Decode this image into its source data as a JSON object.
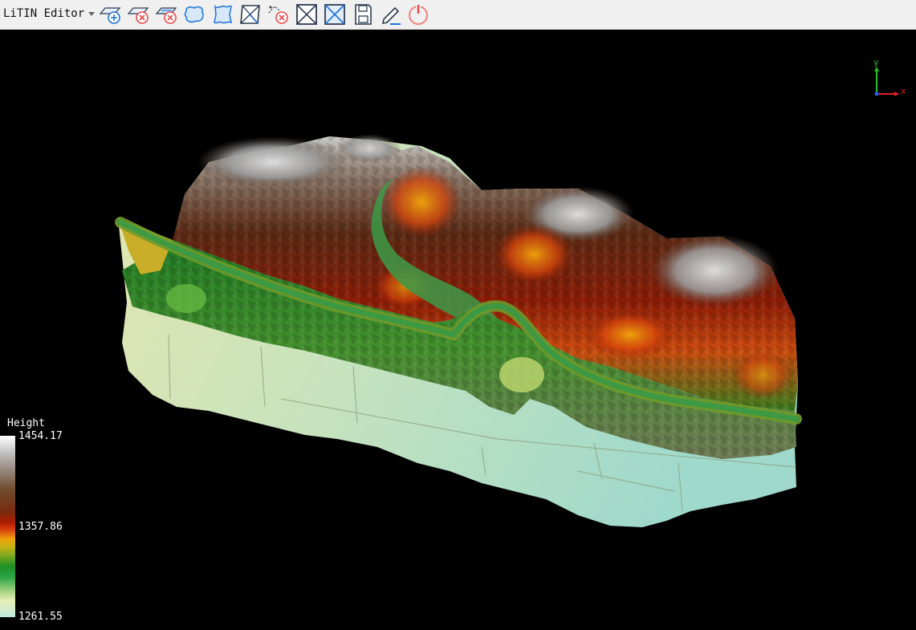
{
  "toolbar": {
    "title": "LiTIN Editor",
    "buttons": [
      {
        "name": "add-tin-button",
        "icon": "plane-add-icon"
      },
      {
        "name": "delete-tin-button",
        "icon": "plane-remove-icon"
      },
      {
        "name": "delete-tin-alt-button",
        "icon": "plane-remove-alt-icon"
      },
      {
        "name": "polygon-select-button",
        "icon": "blob-polygon-icon"
      },
      {
        "name": "polygon-edit-button",
        "icon": "wave-polygon-icon"
      },
      {
        "name": "flatten-button",
        "icon": "box-cross-icon"
      },
      {
        "name": "remove-points-button",
        "icon": "points-remove-icon"
      },
      {
        "name": "clear-area-button",
        "icon": "crossed-box-icon"
      },
      {
        "name": "clear-area-alt-button",
        "icon": "crossed-box-blue-icon"
      },
      {
        "name": "save-button",
        "icon": "floppy-disk-icon"
      },
      {
        "name": "edit-button",
        "icon": "pencil-icon"
      },
      {
        "name": "exit-button",
        "icon": "power-icon"
      }
    ]
  },
  "viewport": {
    "axes": {
      "x": "x",
      "y": "y"
    },
    "legend": {
      "title": "Height",
      "max": "1454.17",
      "mid": "1357.86",
      "min": "1261.55"
    }
  },
  "colors": {
    "accent": "#1f72d8",
    "exit": "#e84a4a",
    "background": "#000000"
  }
}
